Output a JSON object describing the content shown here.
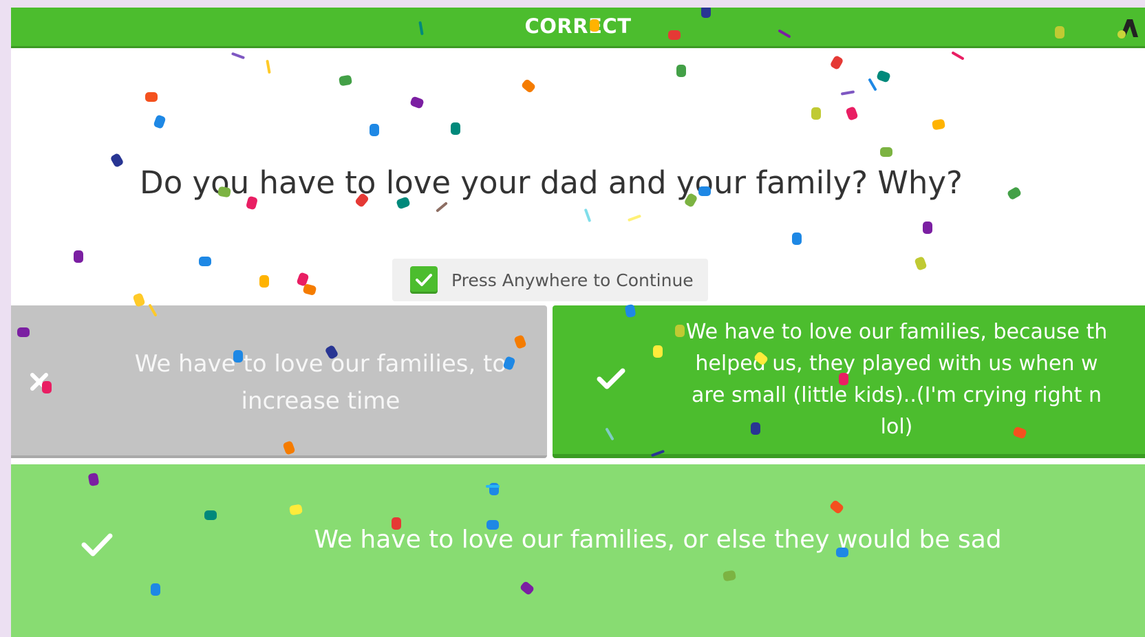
{
  "banner": {
    "label": "CORRECT"
  },
  "question": {
    "text": "Do you have to love your dad and your family? Why?"
  },
  "continue_prompt": {
    "label": "Press Anywhere to Continue"
  },
  "answers": [
    {
      "text": "We have to love our families, to increase time",
      "status": "incorrect",
      "icon": "close-icon"
    },
    {
      "text_lines": [
        "We have to love our families, because th",
        "helped us, they played with us when w",
        "are small (little kids)..(I'm crying right n",
        "lol)"
      ],
      "status": "correct",
      "icon": "check-icon"
    },
    {
      "text": "We have to love our families, or else they would be sad",
      "status": "correct",
      "icon": "check-icon"
    }
  ],
  "colors": {
    "correct_green": "#4cbd2e",
    "light_green": "#88dc72",
    "incorrect_gray": "#c3c3c3",
    "page_background": "#ece0f2"
  },
  "decorations": {
    "effect": "confetti"
  }
}
